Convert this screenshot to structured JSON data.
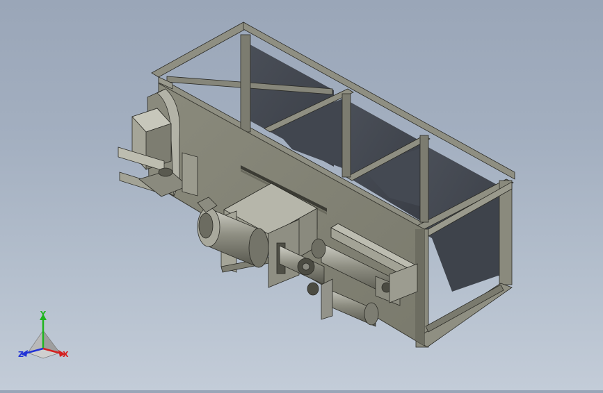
{
  "triad": {
    "x_label": "X",
    "y_label": "Y",
    "z_label": "Z",
    "x_color": "#d42020",
    "y_color": "#1fb51f",
    "z_color": "#2233d6"
  }
}
